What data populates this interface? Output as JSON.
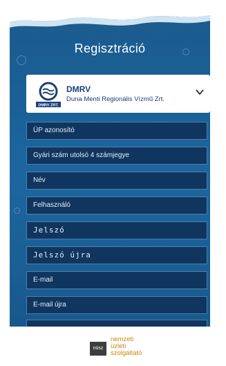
{
  "screen": {
    "title": "Regisztráció"
  },
  "provider": {
    "logo_text": "DMRV ZRT.",
    "name": "DMRV",
    "full_name": "Duna Menti Regionális Vízmű Zrt."
  },
  "fields": [
    {
      "label": "ÜP azonosító",
      "help": "?"
    },
    {
      "label": "Gyári szám utolsó 4 számjegye",
      "help": "?"
    },
    {
      "label": "Név",
      "help": "?"
    },
    {
      "label": "Felhasználó",
      "help": "?"
    },
    {
      "label": "Jelszó",
      "help": "?"
    },
    {
      "label": "Jelszó újra"
    },
    {
      "label": "E-mail",
      "help": "?"
    },
    {
      "label": "E-mail újra"
    }
  ],
  "footer": {
    "logo_text": "nüsz",
    "lines": [
      "nemzeti",
      "üzleti",
      "szolgáltató"
    ]
  },
  "colors": {
    "background": "#1c5a8c",
    "field": "#10365f",
    "footer_accent": "#c8860a"
  }
}
